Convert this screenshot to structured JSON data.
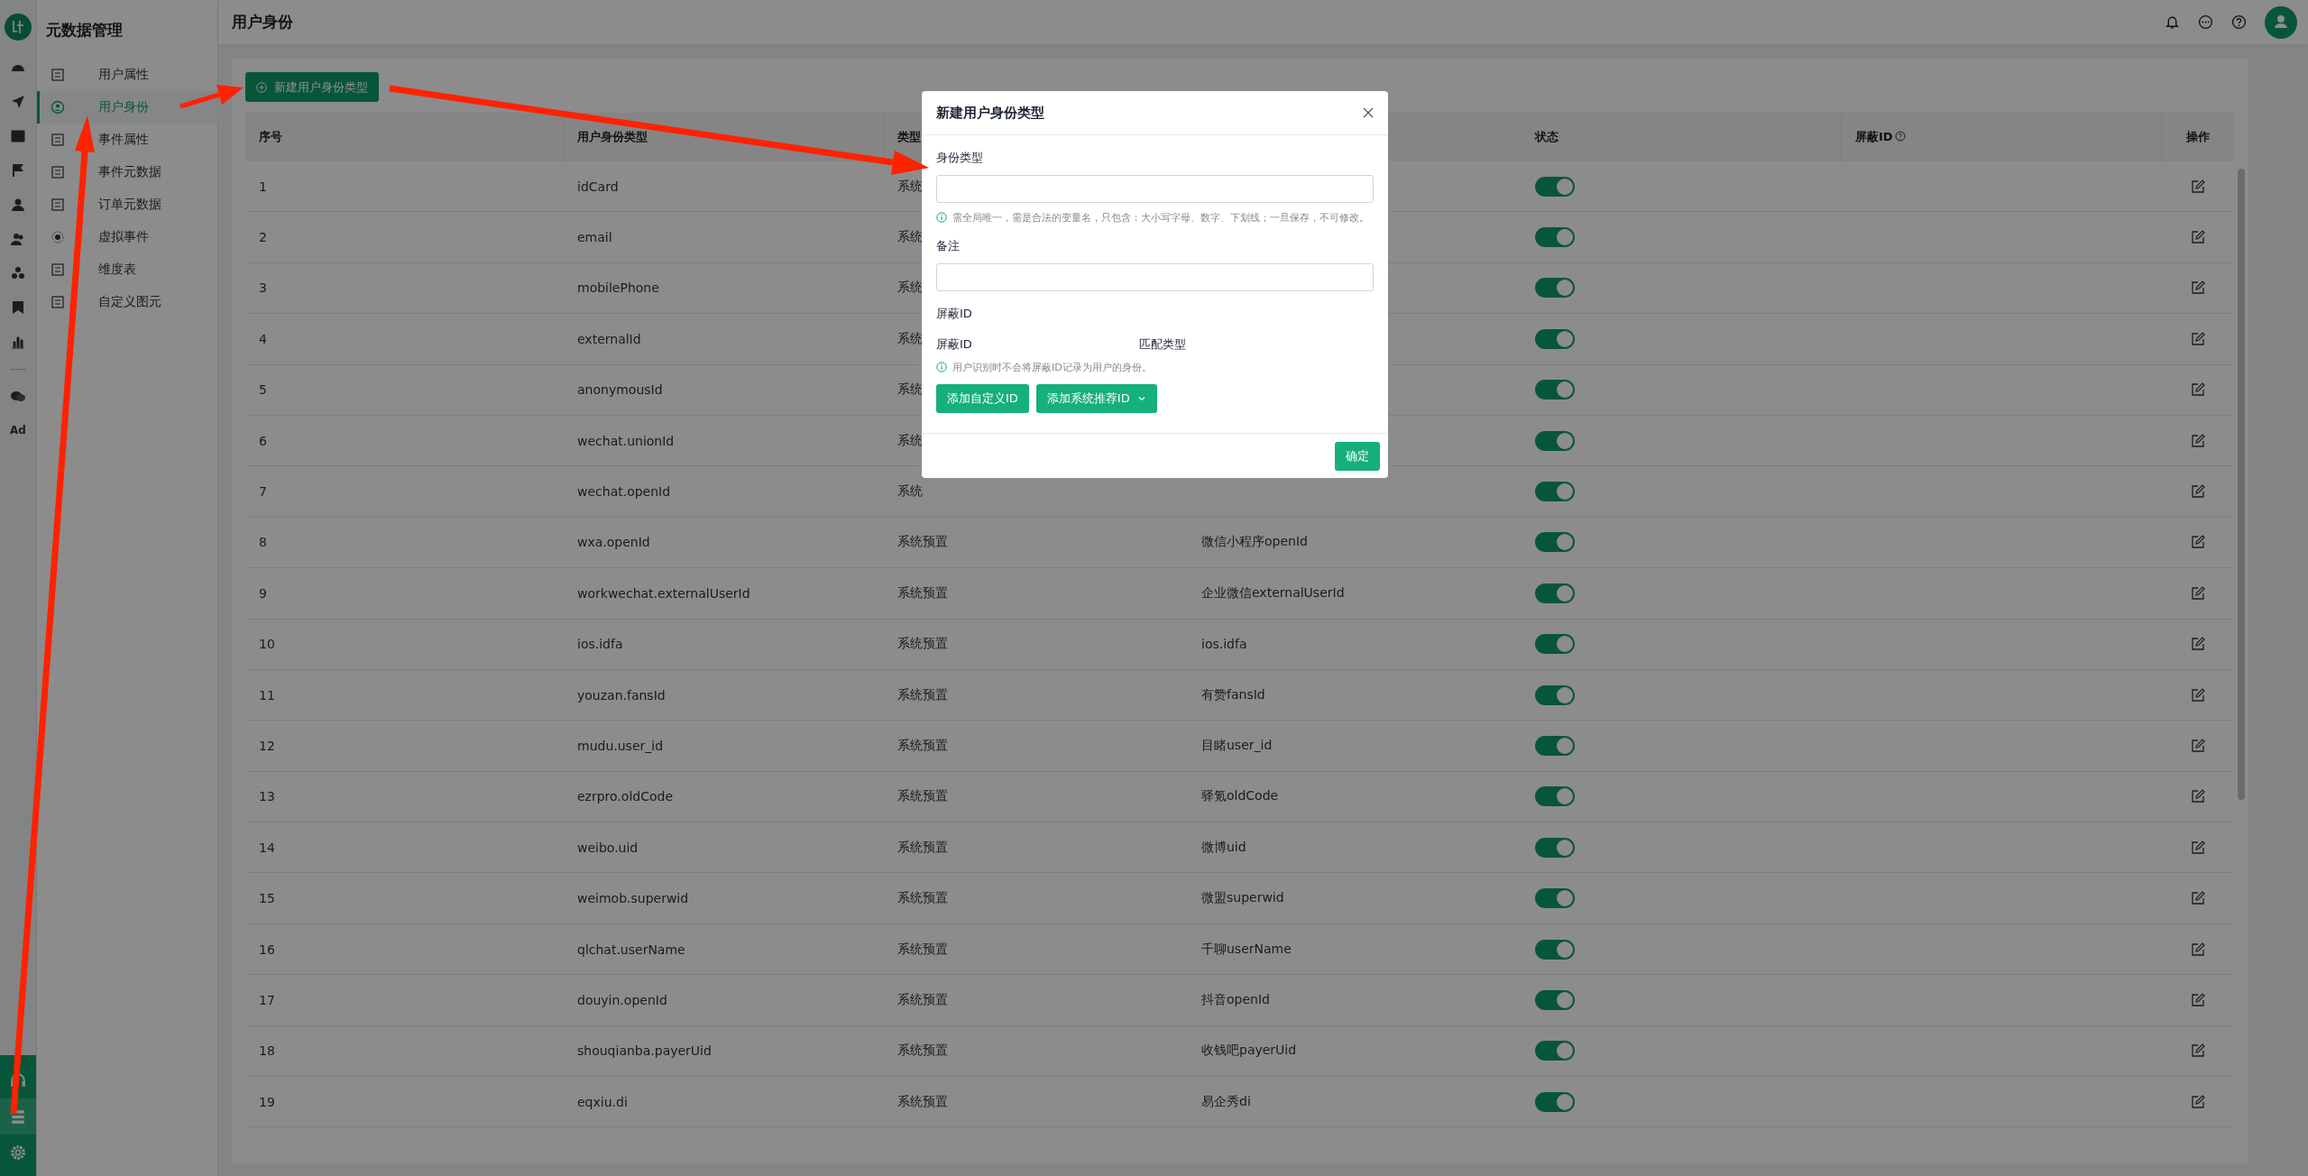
{
  "rail": {
    "ad_label": "Ad",
    "bottom_items": [
      {
        "selected": false
      },
      {
        "selected": true
      },
      {
        "selected": false
      }
    ]
  },
  "sidebar": {
    "title": "元数据管理",
    "items": [
      {
        "label": "用户属性",
        "selected": false
      },
      {
        "label": "用户身份",
        "selected": true
      },
      {
        "label": "事件属性",
        "selected": false
      },
      {
        "label": "事件元数据",
        "selected": false
      },
      {
        "label": "订单元数据",
        "selected": false
      },
      {
        "label": "虚拟事件",
        "selected": false
      },
      {
        "label": "维度表",
        "selected": false
      },
      {
        "label": "自定义图元",
        "selected": false
      }
    ]
  },
  "header": {
    "title": "用户身份"
  },
  "toolbar": {
    "new_button": "新建用户身份类型"
  },
  "table": {
    "columns": [
      {
        "label": "序号",
        "hint": false
      },
      {
        "label": "用户身份类型",
        "hint": false
      },
      {
        "label": "类型",
        "hint": false
      },
      {
        "label": "状态",
        "hint": false
      },
      {
        "label": "屏蔽ID",
        "hint": true
      },
      {
        "label": "操作",
        "hint": false
      }
    ],
    "rows": [
      {
        "no": "1",
        "name": "idCard",
        "type": "系统",
        "enabled": true
      },
      {
        "no": "2",
        "name": "email",
        "type": "系统",
        "enabled": true
      },
      {
        "no": "3",
        "name": "mobilePhone",
        "type": "系统",
        "enabled": true
      },
      {
        "no": "4",
        "name": "externalId",
        "type": "系统",
        "enabled": true
      },
      {
        "no": "5",
        "name": "anonymousId",
        "type": "系统",
        "enabled": true
      },
      {
        "no": "6",
        "name": "wechat.unionId",
        "type": "系统",
        "enabled": true
      },
      {
        "no": "7",
        "name": "wechat.openId",
        "type": "系统",
        "enabled": true
      },
      {
        "no": "8",
        "name": "wxa.openId",
        "type": "系统预置",
        "display": "微信小程序openId",
        "enabled": true
      },
      {
        "no": "9",
        "name": "workwechat.externalUserId",
        "type": "系统预置",
        "display": "企业微信externalUserId",
        "enabled": true
      },
      {
        "no": "10",
        "name": "ios.idfa",
        "type": "系统预置",
        "display": "ios.idfa",
        "enabled": true
      },
      {
        "no": "11",
        "name": "youzan.fansId",
        "type": "系统预置",
        "display": "有赞fansId",
        "enabled": true
      },
      {
        "no": "12",
        "name": "mudu.user_id",
        "type": "系统预置",
        "display": "目睹user_id",
        "enabled": true
      },
      {
        "no": "13",
        "name": "ezrpro.oldCode",
        "type": "系统预置",
        "display": "驿氪oldCode",
        "enabled": true
      },
      {
        "no": "14",
        "name": "weibo.uid",
        "type": "系统预置",
        "display": "微博uid",
        "enabled": true
      },
      {
        "no": "15",
        "name": "weimob.superwid",
        "type": "系统预置",
        "display": "微盟superwid",
        "enabled": true
      },
      {
        "no": "16",
        "name": "qlchat.userName",
        "type": "系统预置",
        "display": "千聊userName",
        "enabled": true
      },
      {
        "no": "17",
        "name": "douyin.openId",
        "type": "系统预置",
        "display": "抖音openId",
        "enabled": true
      },
      {
        "no": "18",
        "name": "shouqianba.payerUid",
        "type": "系统预置",
        "display": "收钱吧payerUid",
        "enabled": true
      },
      {
        "no": "19",
        "name": "eqxiu.di",
        "type": "系统预置",
        "display": "易企秀di",
        "enabled": true
      }
    ]
  },
  "dialog": {
    "title": "新建用户身份类型",
    "fields": [
      {
        "label": "身份类型",
        "hint": "需全局唯一，需是合法的变量名，只包含：大小写字母、数字、下划线；一旦保存，不可修改。"
      },
      {
        "label": "备注"
      }
    ],
    "block_section": {
      "title": "屏蔽ID",
      "columns": [
        "屏蔽ID",
        "匹配类型"
      ],
      "hint": "用户识别时不会将屏蔽ID记录为用户的身份。",
      "buttons": [
        {
          "label": "添加自定义ID",
          "kind": "plain"
        },
        {
          "label": "添加系统推荐ID",
          "kind": "dropdown"
        }
      ]
    },
    "confirm_button": "确定"
  }
}
